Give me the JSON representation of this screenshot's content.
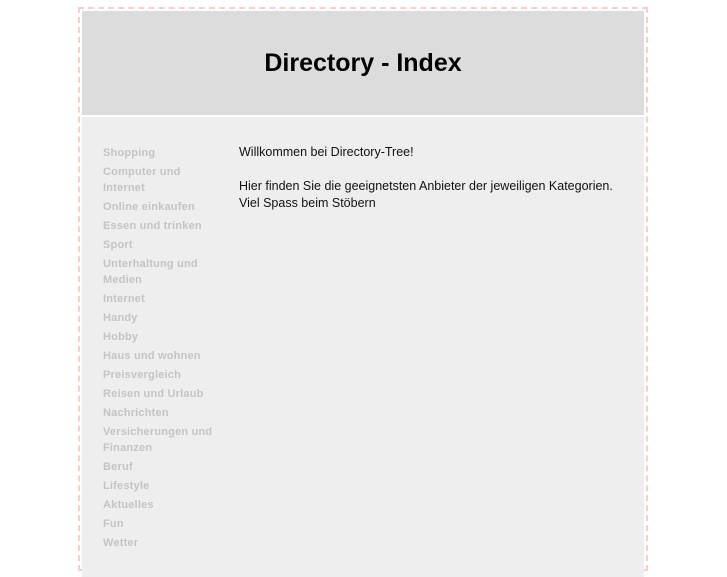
{
  "header": {
    "title": "Directory - Index"
  },
  "sidebar": {
    "items": [
      {
        "label": "Shopping"
      },
      {
        "label": "Computer und Internet"
      },
      {
        "label": "Online einkaufen"
      },
      {
        "label": "Essen und trinken"
      },
      {
        "label": "Sport"
      },
      {
        "label": "Unterhaltung und Medien"
      },
      {
        "label": "Internet"
      },
      {
        "label": "Handy"
      },
      {
        "label": "Hobby"
      },
      {
        "label": "Haus und wohnen"
      },
      {
        "label": "Preisvergleich"
      },
      {
        "label": "Reisen und Urlaub"
      },
      {
        "label": "Nachrichten"
      },
      {
        "label": "Versicherungen und Finanzen"
      },
      {
        "label": "Beruf"
      },
      {
        "label": "Lifestyle"
      },
      {
        "label": "Aktuelles"
      },
      {
        "label": "Fun"
      },
      {
        "label": "Wetter"
      }
    ]
  },
  "content": {
    "welcome": "Willkommen bei Directory-Tree!",
    "intro": "Hier finden Sie die geeignetsten Anbieter der jeweiligen Kategorien. Viel Spass beim Stöbern"
  },
  "colors": {
    "header_bg": "#dcdcdc",
    "body_bg": "#eeeeee",
    "border": "#f7cfcf",
    "nav_link": "#c4c4c4"
  }
}
